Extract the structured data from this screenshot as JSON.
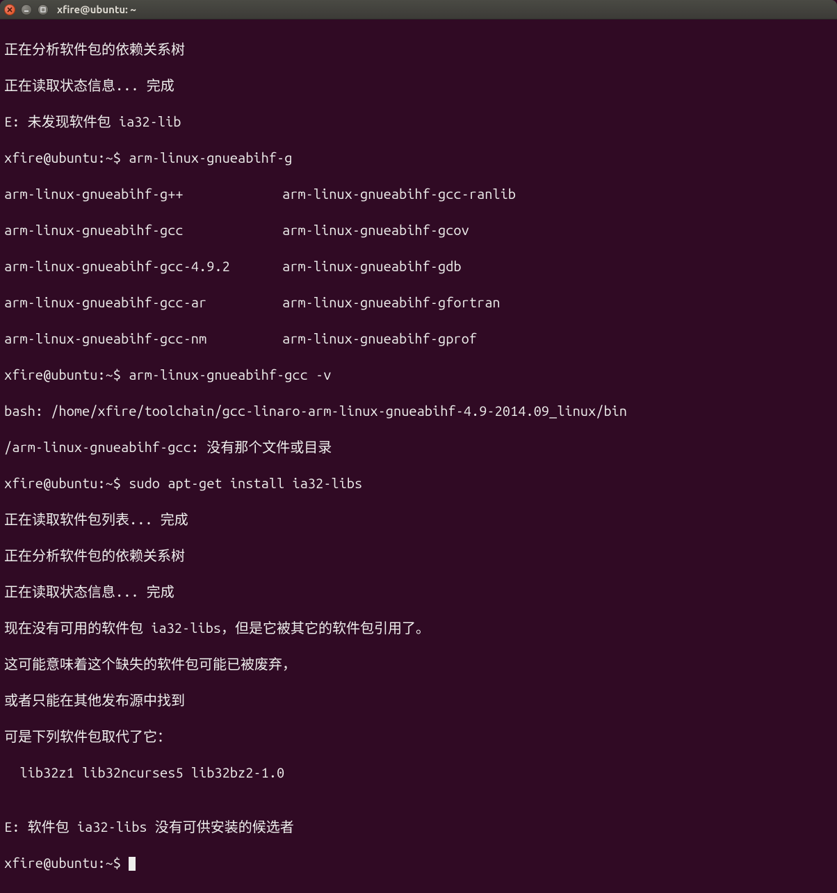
{
  "window": {
    "title": "xfire@ubuntu: ~"
  },
  "lines": {
    "l0": "正在分析软件包的依赖关系树",
    "l1": "正在读取状态信息... 完成",
    "l2": "E: 未发现软件包 ia32-lib",
    "l3_prompt": "xfire@ubuntu:~$ ",
    "l3_cmd": "arm-linux-gnueabihf-g",
    "comp": {
      "c1a": "arm-linux-gnueabihf-g++",
      "c1b": "arm-linux-gnueabihf-gcc-ranlib",
      "c2a": "arm-linux-gnueabihf-gcc",
      "c2b": "arm-linux-gnueabihf-gcov",
      "c3a": "arm-linux-gnueabihf-gcc-4.9.2",
      "c3b": "arm-linux-gnueabihf-gdb",
      "c4a": "arm-linux-gnueabihf-gcc-ar",
      "c4b": "arm-linux-gnueabihf-gfortran",
      "c5a": "arm-linux-gnueabihf-gcc-nm",
      "c5b": "arm-linux-gnueabihf-gprof"
    },
    "l9_prompt": "xfire@ubuntu:~$ ",
    "l9_cmd": "arm-linux-gnueabihf-gcc -v",
    "l10": "bash: /home/xfire/toolchain/gcc-linaro-arm-linux-gnueabihf-4.9-2014.09_linux/bin",
    "l11": "/arm-linux-gnueabihf-gcc: 没有那个文件或目录",
    "l12_prompt": "xfire@ubuntu:~$ ",
    "l12_cmd": "sudo apt-get install ia32-libs",
    "l13": "正在读取软件包列表... 完成",
    "l14": "正在分析软件包的依赖关系树",
    "l15": "正在读取状态信息... 完成",
    "l16": "现在没有可用的软件包 ia32-libs，但是它被其它的软件包引用了。",
    "l17": "这可能意味着这个缺失的软件包可能已被废弃，",
    "l18": "或者只能在其他发布源中找到",
    "l19": "可是下列软件包取代了它：",
    "l20": "  lib32z1 lib32ncurses5 lib32bz2-1.0",
    "l21": "",
    "l22": "E: 软件包 ia32-libs 没有可供安装的候选者",
    "l23_prompt": "xfire@ubuntu:~$ "
  }
}
